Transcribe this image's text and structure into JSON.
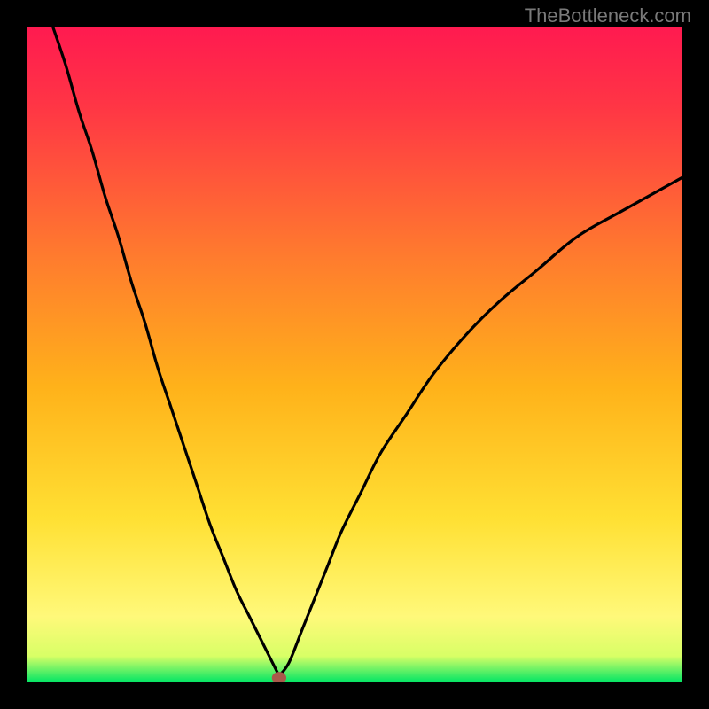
{
  "watermark": "TheBottleneck.com",
  "colors": {
    "gradient_stops": [
      {
        "offset": 0.0,
        "color": "#ff1a50"
      },
      {
        "offset": 0.12,
        "color": "#ff3545"
      },
      {
        "offset": 0.35,
        "color": "#ff7b2e"
      },
      {
        "offset": 0.55,
        "color": "#ffb21a"
      },
      {
        "offset": 0.75,
        "color": "#ffe033"
      },
      {
        "offset": 0.9,
        "color": "#fff97a"
      },
      {
        "offset": 0.96,
        "color": "#d8ff66"
      },
      {
        "offset": 1.0,
        "color": "#00e565"
      }
    ],
    "curve_stroke": "#000000",
    "marker_fill": "#a95a4a",
    "frame": "#000000"
  },
  "chart_data": {
    "type": "line",
    "title": "",
    "xlabel": "",
    "ylabel": "",
    "xlim": [
      0,
      100
    ],
    "ylim": [
      0,
      100
    ],
    "grid": false,
    "series": [
      {
        "name": "left-branch",
        "x": [
          4,
          6,
          8,
          10,
          12,
          14,
          16,
          18,
          20,
          22,
          24,
          26,
          28,
          30,
          32,
          34,
          36,
          37.5,
          38.5
        ],
        "y": [
          100,
          94,
          87,
          81,
          74,
          68,
          61,
          55,
          48,
          42,
          36,
          30,
          24,
          19,
          14,
          10,
          6,
          3,
          1
        ]
      },
      {
        "name": "right-branch",
        "x": [
          38.5,
          40,
          42,
          44,
          46,
          48,
          51,
          54,
          58,
          62,
          67,
          72,
          78,
          84,
          91,
          100
        ],
        "y": [
          1,
          3,
          8,
          13,
          18,
          23,
          29,
          35,
          41,
          47,
          53,
          58,
          63,
          68,
          72,
          77
        ]
      }
    ],
    "marker": {
      "x": 38.5,
      "y": 0.7,
      "rx": 1.1,
      "ry": 0.9
    },
    "annotations": []
  }
}
